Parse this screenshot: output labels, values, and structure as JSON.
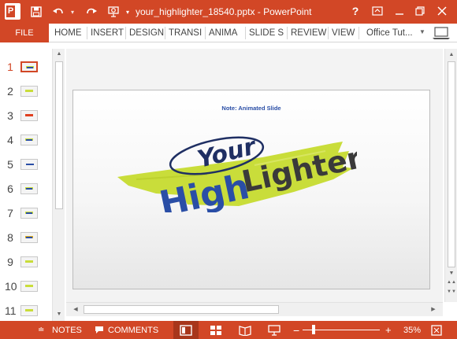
{
  "titlebar": {
    "title": "your_highlighter_18540.pptx - PowerPoint",
    "logo_letter": "P"
  },
  "ribbon": {
    "file_label": "FILE",
    "tabs": [
      "HOME",
      "INSERT",
      "DESIGN",
      "TRANSI",
      "ANIMA",
      "SLIDE S",
      "REVIEW",
      "VIEW"
    ],
    "account": "Office Tut..."
  },
  "thumbnails": {
    "numbers": [
      "1",
      "2",
      "3",
      "4",
      "5",
      "6",
      "7",
      "8",
      "9",
      "10",
      "11"
    ],
    "active_index": 0
  },
  "slide": {
    "note": "Note: Animated Slide",
    "logo_word1": "Your",
    "logo_word2_a": "High",
    "logo_word2_b": "Lighter"
  },
  "status": {
    "notes_label": "NOTES",
    "comments_label": "COMMENTS",
    "zoom": "35%"
  },
  "colors": {
    "accent": "#d24726",
    "highlighter": "#c9dd3a",
    "blue": "#2a4ea6",
    "dark": "#3a3a3a"
  }
}
